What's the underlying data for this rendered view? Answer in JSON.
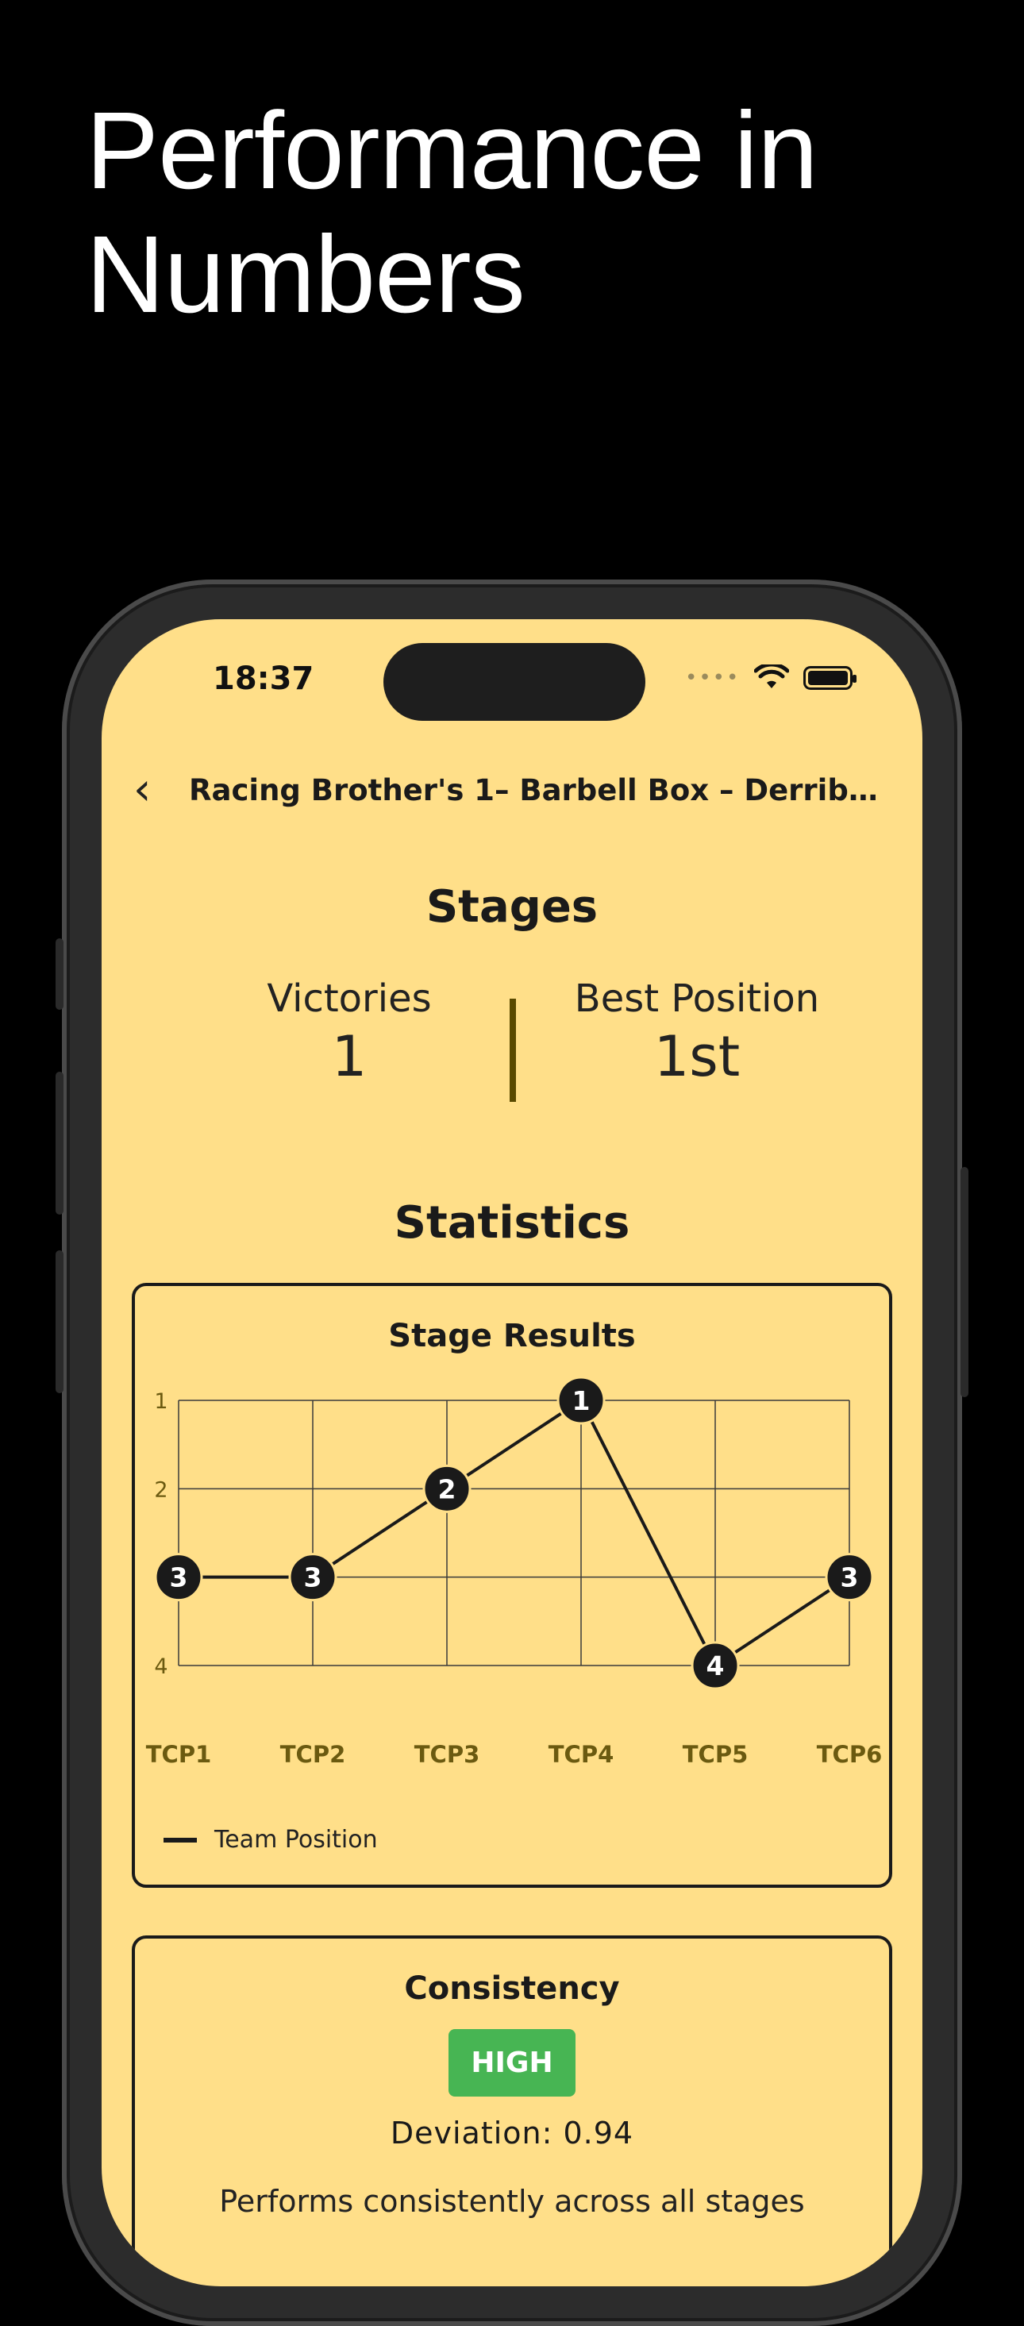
{
  "headline": "Performance in Numbers",
  "status_bar": {
    "time": "18:37"
  },
  "nav": {
    "back_label": "‹",
    "title": "Racing Brother's 1– Barbell Box – Derribo…"
  },
  "stages": {
    "title": "Stages",
    "victories_label": "Victories",
    "victories_value": "1",
    "best_position_label": "Best Position",
    "best_position_value": "1st"
  },
  "statistics_title": "Statistics",
  "chart_data": {
    "type": "line",
    "title": "Stage Results",
    "categories": [
      "TCP1",
      "TCP2",
      "TCP3",
      "TCP4",
      "TCP5",
      "TCP6"
    ],
    "series": [
      {
        "name": "Team Position",
        "values": [
          3,
          3,
          2,
          1,
          4,
          3
        ]
      }
    ],
    "y_ticks": [
      "1",
      "2",
      "4"
    ],
    "ylim": [
      1,
      4
    ],
    "y_inverted": true,
    "grid": true,
    "legend_position": "bottom-left",
    "colors": {
      "line": "#1a1a1a",
      "grid": "#3a3a3a",
      "tick": "#6b5a10"
    }
  },
  "consistency": {
    "title": "Consistency",
    "badge": "HIGH",
    "deviation": "Deviation: 0.94",
    "description": "Performs consistently across all stages"
  },
  "colors": {
    "screen_bg": "#ffdf89",
    "badge_green": "#47b553"
  }
}
